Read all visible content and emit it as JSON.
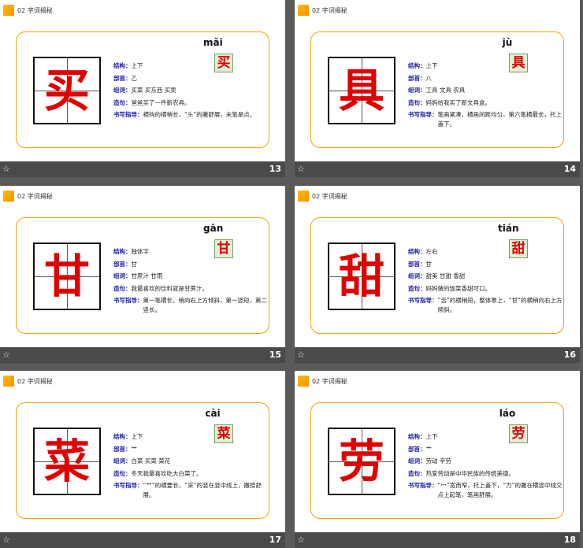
{
  "header_text": "02  字词揭秘",
  "labels": {
    "structure": "结构：",
    "radical": "部首：",
    "words": "组词：",
    "sentence": "造句：",
    "guide": "书写指导："
  },
  "footer_icon": "star-icon",
  "colors": {
    "accent": "#f0a500",
    "char_red": "#e00000",
    "label_blue": "#1a1aaa",
    "background": "#5a5a5a"
  },
  "slides": [
    {
      "char": "买",
      "pinyin": "mǎi",
      "structure": "上下",
      "radical": "乙",
      "words": "买菜   买东西    买卖",
      "sentence": "爸爸买了一件新农具。",
      "guide": "横钩的横稍长，“头”的撇舒展，末笔是点。",
      "number": "13"
    },
    {
      "char": "具",
      "pinyin": "jù",
      "structure": "上下",
      "radical": "八",
      "words": "工具   文具   农具",
      "sentence": "妈妈给我买了新文具盒。",
      "guide": "笔画紧凑，横画间距均匀，第六笔横最长，托上盖下。",
      "number": "14"
    },
    {
      "char": "甘",
      "pinyin": "gān",
      "structure": "独体字",
      "radical": "甘",
      "words": "甘蔗汁  甘雨",
      "sentence": "我最喜欢的饮料就是甘蔗汁。",
      "guide": "第一笔横长，稍向右上方倾斜，第一竖短，第二竖长。",
      "number": "15"
    },
    {
      "char": "甜",
      "pinyin": "tián",
      "structure": "左右",
      "radical": "甘",
      "words": "甜美   甘甜    香甜",
      "sentence": "妈妈做的饭菜香甜可口。",
      "guide": "“舌”的横稍短，整体靠上，“甘”的横稍向右上方倾斜。",
      "number": "16"
    },
    {
      "char": "菜",
      "pinyin": "cài",
      "structure": "上下",
      "radical": "艹",
      "words": "白菜   买菜    菜花",
      "sentence": "冬天我最喜欢吃大白菜了。",
      "guide": "“艹”的横要长，“采”的竖在竖中线上，撇捺舒展。",
      "number": "17"
    },
    {
      "char": "劳",
      "pinyin": "láo",
      "structure": "上下",
      "radical": "艹",
      "words": "劳动   辛劳",
      "sentence": "热爱劳动是中华民族的传统美德。",
      "guide": "“冖”宽而窄，托上盖下，“力”的撇在横竖中线交点上起笔，笔画舒展。",
      "number": "18"
    }
  ]
}
